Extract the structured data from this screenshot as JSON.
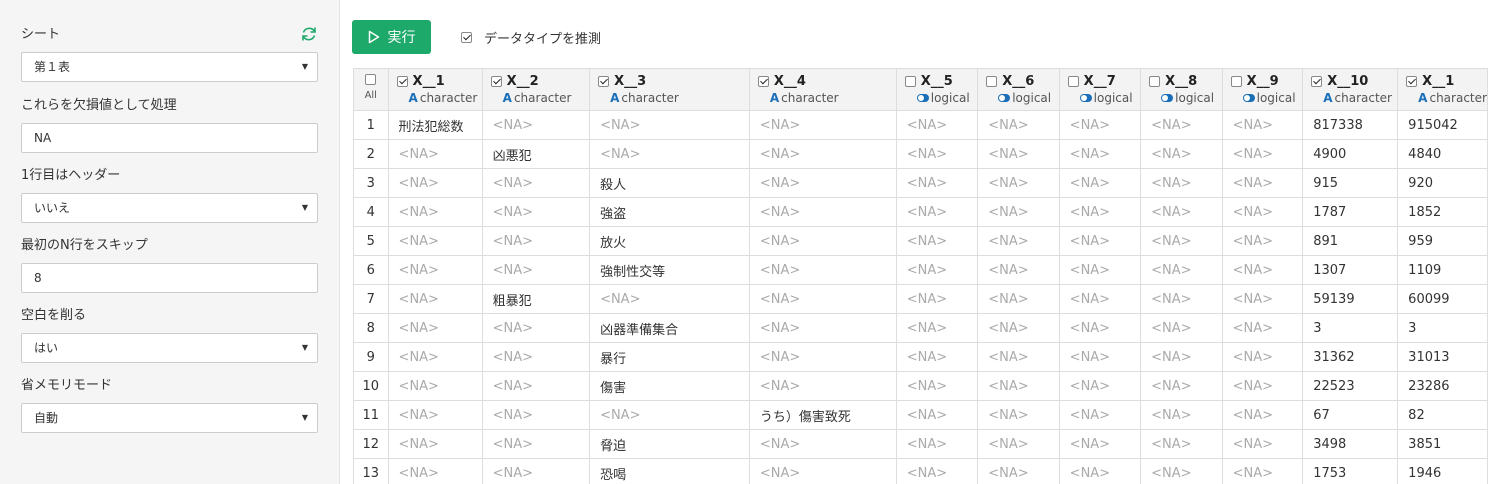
{
  "sidebar": {
    "sheet_label": "シート",
    "sheet_value": "第１表",
    "na_label": "これらを欠損値として処理",
    "na_value": "NA",
    "header_label": "1行目はヘッダー",
    "header_value": "いいえ",
    "skip_label": "最初のN行をスキップ",
    "skip_value": "8",
    "trim_label": "空白を削る",
    "trim_value": "はい",
    "memory_label": "省メモリモード",
    "memory_value": "自動"
  },
  "toolbar": {
    "run_label": "実行",
    "guess_label": "データタイプを推測",
    "guess_checked": true
  },
  "colors": {
    "accent": "#1ca96a",
    "type_icon": "#1a6fb8",
    "na_text": "#aaaaaa"
  },
  "table": {
    "all_label": "All",
    "columns": [
      {
        "name": "X__1",
        "type": "character",
        "checked": true
      },
      {
        "name": "X__2",
        "type": "character",
        "checked": true
      },
      {
        "name": "X__3",
        "type": "character",
        "checked": true
      },
      {
        "name": "X__4",
        "type": "character",
        "checked": true
      },
      {
        "name": "X__5",
        "type": "logical",
        "checked": false
      },
      {
        "name": "X__6",
        "type": "logical",
        "checked": false
      },
      {
        "name": "X__7",
        "type": "logical",
        "checked": false
      },
      {
        "name": "X__8",
        "type": "logical",
        "checked": false
      },
      {
        "name": "X__9",
        "type": "logical",
        "checked": false
      },
      {
        "name": "X__10",
        "type": "character",
        "checked": true
      },
      {
        "name": "X__1",
        "type": "character",
        "checked": true
      }
    ],
    "rows": [
      [
        "1",
        "刑法犯総数",
        "<NA>",
        "<NA>",
        "<NA>",
        "<NA>",
        "<NA>",
        "<NA>",
        "<NA>",
        "<NA>",
        "817338",
        "915042"
      ],
      [
        "2",
        "<NA>",
        "凶悪犯",
        "<NA>",
        "<NA>",
        "<NA>",
        "<NA>",
        "<NA>",
        "<NA>",
        "<NA>",
        "4900",
        "4840"
      ],
      [
        "3",
        "<NA>",
        "<NA>",
        "殺人",
        "<NA>",
        "<NA>",
        "<NA>",
        "<NA>",
        "<NA>",
        "<NA>",
        "915",
        "920"
      ],
      [
        "4",
        "<NA>",
        "<NA>",
        "強盗",
        "<NA>",
        "<NA>",
        "<NA>",
        "<NA>",
        "<NA>",
        "<NA>",
        "1787",
        "1852"
      ],
      [
        "5",
        "<NA>",
        "<NA>",
        "放火",
        "<NA>",
        "<NA>",
        "<NA>",
        "<NA>",
        "<NA>",
        "<NA>",
        "891",
        "959"
      ],
      [
        "6",
        "<NA>",
        "<NA>",
        "強制性交等",
        "<NA>",
        "<NA>",
        "<NA>",
        "<NA>",
        "<NA>",
        "<NA>",
        "1307",
        "1109"
      ],
      [
        "7",
        "<NA>",
        "粗暴犯",
        "<NA>",
        "<NA>",
        "<NA>",
        "<NA>",
        "<NA>",
        "<NA>",
        "<NA>",
        "59139",
        "60099"
      ],
      [
        "8",
        "<NA>",
        "<NA>",
        "凶器準備集合",
        "<NA>",
        "<NA>",
        "<NA>",
        "<NA>",
        "<NA>",
        "<NA>",
        "3",
        "3"
      ],
      [
        "9",
        "<NA>",
        "<NA>",
        "暴行",
        "<NA>",
        "<NA>",
        "<NA>",
        "<NA>",
        "<NA>",
        "<NA>",
        "31362",
        "31013"
      ],
      [
        "10",
        "<NA>",
        "<NA>",
        "傷害",
        "<NA>",
        "<NA>",
        "<NA>",
        "<NA>",
        "<NA>",
        "<NA>",
        "22523",
        "23286"
      ],
      [
        "11",
        "<NA>",
        "<NA>",
        "<NA>",
        "うち）傷害致死",
        "<NA>",
        "<NA>",
        "<NA>",
        "<NA>",
        "<NA>",
        "67",
        "82"
      ],
      [
        "12",
        "<NA>",
        "<NA>",
        "脅迫",
        "<NA>",
        "<NA>",
        "<NA>",
        "<NA>",
        "<NA>",
        "<NA>",
        "3498",
        "3851"
      ],
      [
        "13",
        "<NA>",
        "<NA>",
        "恐喝",
        "<NA>",
        "<NA>",
        "<NA>",
        "<NA>",
        "<NA>",
        "<NA>",
        "1753",
        "1946"
      ]
    ]
  }
}
